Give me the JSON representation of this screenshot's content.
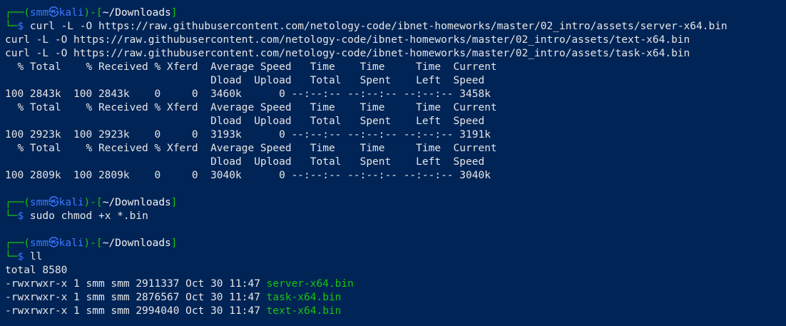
{
  "prompts": [
    {
      "box_top": "┌──(",
      "user": "smm",
      "at": "㉿",
      "host": "kali",
      "mid": ")-[",
      "path": "~/Downloads",
      "close": "]",
      "box_bottom": "└─",
      "dollar": "$",
      "command": " curl -L -O https://raw.githubusercontent.com/netology-code/ibnet-homeworks/master/02_intro/assets/server-x64.bin"
    },
    {
      "box_top": "┌──(",
      "user": "smm",
      "at": "㉿",
      "host": "kali",
      "mid": ")-[",
      "path": "~/Downloads",
      "close": "]",
      "box_bottom": "└─",
      "dollar": "$",
      "command": " sudo chmod +x *.bin"
    },
    {
      "box_top": "┌──(",
      "user": "smm",
      "at": "㉿",
      "host": "kali",
      "mid": ")-[",
      "path": "~/Downloads",
      "close": "]",
      "box_bottom": "└─",
      "dollar": "$",
      "command": " ll"
    }
  ],
  "curl_continuations": [
    "curl -L -O https://raw.githubusercontent.com/netology-code/ibnet-homeworks/master/02_intro/assets/text-x64.bin",
    "curl -L -O https://raw.githubusercontent.com/netology-code/ibnet-homeworks/master/02_intro/assets/task-x64.bin"
  ],
  "progress_tables": [
    {
      "header1": "  % Total    % Received % Xferd  Average Speed   Time    Time     Time  Current",
      "header2": "                                 Dload  Upload   Total   Spent    Left  Speed",
      "row": "100 2843k  100 2843k    0     0  3460k      0 --:--:-- --:--:-- --:--:-- 3458k"
    },
    {
      "header1": "  % Total    % Received % Xferd  Average Speed   Time    Time     Time  Current",
      "header2": "                                 Dload  Upload   Total   Spent    Left  Speed",
      "row": "100 2923k  100 2923k    0     0  3193k      0 --:--:-- --:--:-- --:--:-- 3191k"
    },
    {
      "header1": "  % Total    % Received % Xferd  Average Speed   Time    Time     Time  Current",
      "header2": "                                 Dload  Upload   Total   Spent    Left  Speed",
      "row": "100 2809k  100 2809k    0     0  3040k      0 --:--:-- --:--:-- --:--:-- 3040k"
    }
  ],
  "ls_output": {
    "total": "total 8580",
    "entries": [
      {
        "meta": "-rwxrwxr-x 1 smm smm 2911337 Oct 30 11:47 ",
        "name": "server-x64.bin"
      },
      {
        "meta": "-rwxrwxr-x 1 smm smm 2876567 Oct 30 11:47 ",
        "name": "task-x64.bin"
      },
      {
        "meta": "-rwxrwxr-x 1 smm smm 2994040 Oct 30 11:47 ",
        "name": "text-x64.bin"
      }
    ]
  },
  "colors": {
    "background": "#012456",
    "prompt_green": "#16c60c",
    "prompt_blue": "#3b78ff",
    "text": "#e6e6e6"
  }
}
